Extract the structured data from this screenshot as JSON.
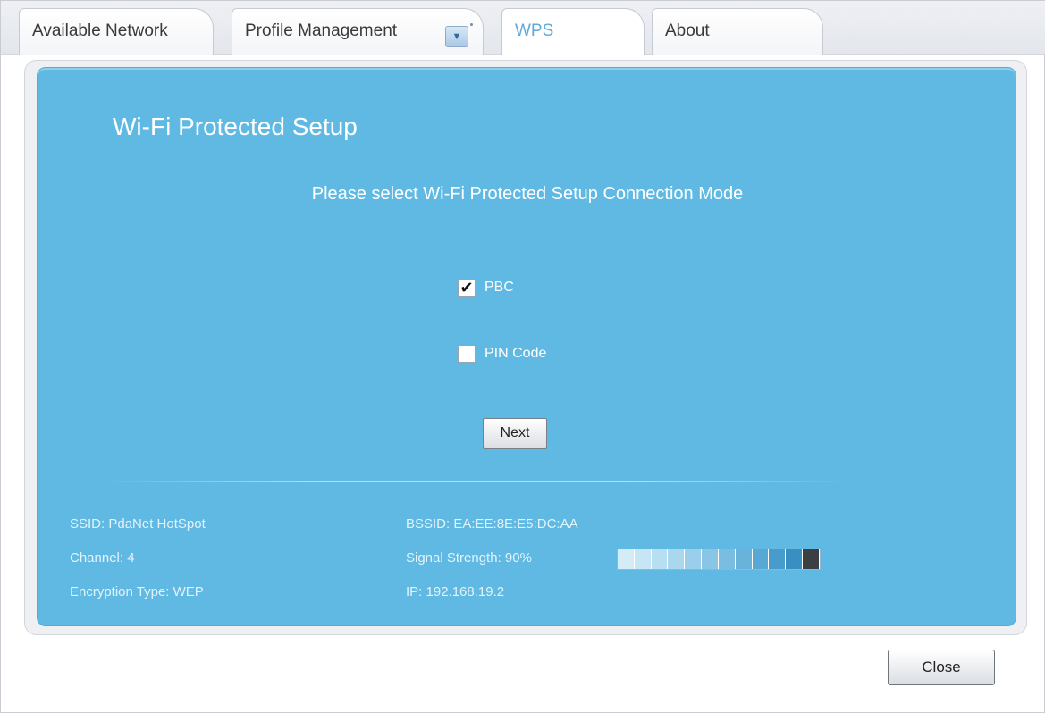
{
  "tabs": [
    {
      "label": "Available Network"
    },
    {
      "label": "Profile Management"
    },
    {
      "label": "WPS"
    },
    {
      "label": "About"
    }
  ],
  "panel": {
    "title": "Wi-Fi Protected Setup",
    "subtitle": "Please select Wi-Fi Protected Setup Connection Mode"
  },
  "options": {
    "pbc": {
      "label": "PBC",
      "checked": true
    },
    "pin": {
      "label": "PIN Code",
      "checked": false
    }
  },
  "buttons": {
    "next": "Next",
    "close": "Close"
  },
  "status": {
    "ssid": "SSID: PdaNet HotSpot",
    "channel": "Channel: 4",
    "encryption": "Encryption Type: WEP",
    "bssid": "BSSID: EA:EE:8E:E5:DC:AA",
    "signal_text": "Signal Strength: 90%",
    "signal_level": 0.9,
    "ip": "IP: 192.168.19.2"
  },
  "colors": {
    "panel": "#5fb9e3",
    "active_tab_text": "#63a9d8"
  }
}
